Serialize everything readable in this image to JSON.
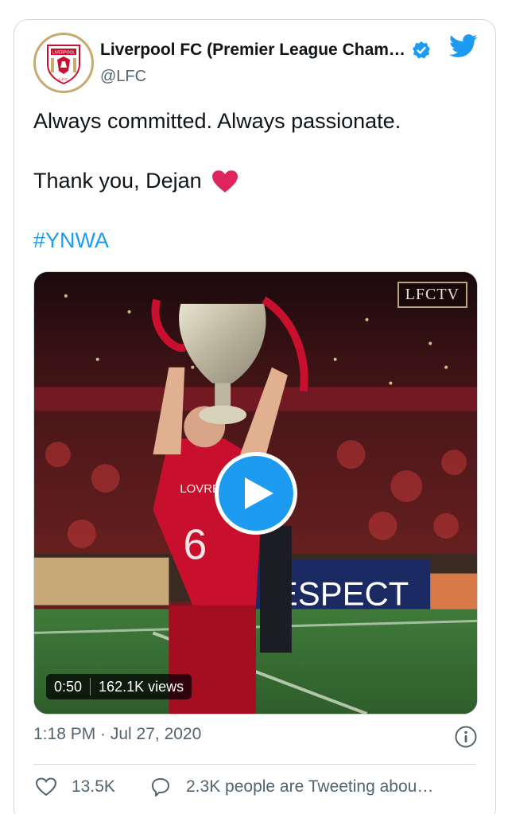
{
  "tweet": {
    "author": {
      "display_name": "Liverpool FC (Premier League Cham…",
      "handle": "@LFC",
      "verified": true,
      "avatar_icon": "lfc-crest-icon"
    },
    "platform_icon": "twitter-bird-icon",
    "text_line_1": "Always committed. Always passionate.",
    "text_line_2": "Thank you, Dejan",
    "text_line_2_emoji": "red-heart-icon",
    "hashtag": "#YNWA",
    "media": {
      "watermark": "LFCTV",
      "duration": "0:50",
      "views": "162.1K views",
      "board_text": "ESPECT",
      "shirt_number": "6",
      "shirt_name": "LOVREN"
    },
    "timestamp": "1:18 PM · Jul 27, 2020",
    "likes": "13.5K",
    "conversation": "2.3K people are Tweeting abou…"
  },
  "colors": {
    "accent": "#1d9bf0",
    "heart": "#e0245e",
    "muted": "#536471",
    "border": "#cfd9de",
    "crest_gold": "#c8a96e",
    "crest_red": "#c8102e"
  }
}
